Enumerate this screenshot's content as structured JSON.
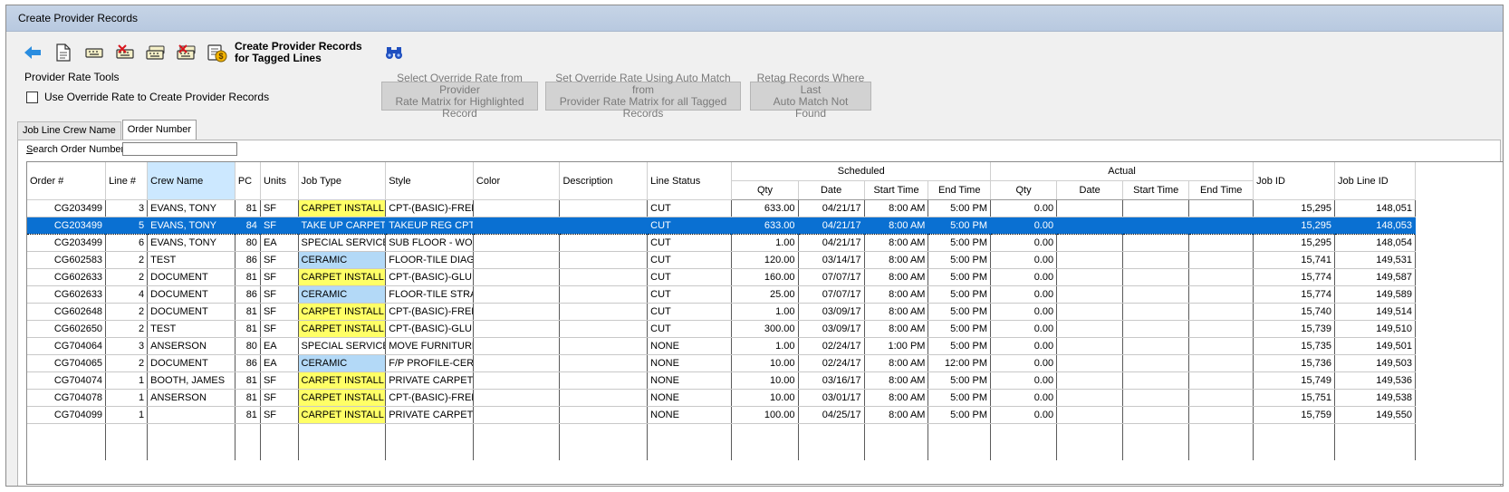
{
  "window": {
    "title": "Create Provider Records"
  },
  "toolbar": {
    "buttons": [
      {
        "icon": "back-arrow-icon"
      },
      {
        "icon": "document-page-icon"
      },
      {
        "icon": "keyboard-tag-icon"
      },
      {
        "icon": "keyboard-untag-icon"
      },
      {
        "icon": "keyboard-tag-all-icon"
      },
      {
        "icon": "keyboard-untag-all-icon"
      },
      {
        "icon": "provider-records-icon"
      },
      {
        "icon": "binoculars-find-icon"
      }
    ],
    "create_label_line1": "Create Provider Records",
    "create_label_line2": "for Tagged Lines"
  },
  "rate_tools": {
    "section_label": "Provider Rate Tools",
    "override_checkbox_label": "Use Override Rate to Create Provider Records",
    "override_checked": false,
    "btn_select_line1": "Select Override Rate from Provider",
    "btn_select_line2": "Rate Matrix for Highlighted Record",
    "btn_auto_line1": "Set Override Rate Using Auto Match from",
    "btn_auto_line2": "Provider Rate Matrix for all Tagged Records",
    "btn_retag_line1": "Retag Records Where Last",
    "btn_retag_line2": "Auto Match Not Found"
  },
  "tabs": [
    {
      "label": "Job Line Crew Name",
      "active": false
    },
    {
      "label": "Order Number",
      "active": true
    }
  ],
  "search": {
    "label_accel": "S",
    "label_rest": "earch Order Number",
    "value": ""
  },
  "grid": {
    "headers": {
      "order": "Order #",
      "line": "Line #",
      "crew": "Crew Name",
      "pc": "PC",
      "units": "Units",
      "job_type": "Job Type",
      "style": "Style",
      "color": "Color",
      "description": "Description",
      "line_status": "Line Status",
      "scheduled": "Scheduled",
      "actual": "Actual",
      "sched_qty": "Qty",
      "sched_date": "Date",
      "sched_start": "Start Time",
      "sched_end": "End Time",
      "act_qty": "Qty",
      "act_date": "Date",
      "act_start": "Start Time",
      "act_end": "End Time",
      "job_id": "Job ID",
      "job_line_id": "Job Line ID"
    },
    "colors": {
      "selected_row": "#0a70d2",
      "job_type_yellow": "#ffff66",
      "job_type_blue": "#b3d9f7"
    },
    "rows": [
      {
        "order": "CG203499",
        "line": "3",
        "crew": "EVANS, TONY",
        "pc": "81",
        "units": "SF",
        "job_type": "CARPET INSTALL",
        "jt_color": "yellow",
        "style": "CPT-(BASIC)-FREE",
        "color": "",
        "description": "",
        "status": "CUT",
        "qty": "633.00",
        "date": "04/21/17",
        "start": "8:00 AM",
        "end": "5:00 PM",
        "aqty": "0.00",
        "adate": "",
        "astart": "",
        "aend": "",
        "job_id": "15,295",
        "job_line_id": "148,051",
        "selected": false
      },
      {
        "order": "CG203499",
        "line": "5",
        "crew": "EVANS, TONY",
        "pc": "84",
        "units": "SF",
        "job_type": "TAKE UP CARPET",
        "jt_color": "",
        "style": "TAKEUP REG CPT",
        "color": "",
        "description": "",
        "status": "CUT",
        "qty": "633.00",
        "date": "04/21/17",
        "start": "8:00 AM",
        "end": "5:00 PM",
        "aqty": "0.00",
        "adate": "",
        "astart": "",
        "aend": "",
        "job_id": "15,295",
        "job_line_id": "148,053",
        "selected": true
      },
      {
        "order": "CG203499",
        "line": "6",
        "crew": "EVANS, TONY",
        "pc": "80",
        "units": "EA",
        "job_type": "SPECIAL SERVICE",
        "jt_color": "",
        "style": "SUB FLOOR - WO",
        "color": "",
        "description": "",
        "status": "CUT",
        "qty": "1.00",
        "date": "04/21/17",
        "start": "8:00 AM",
        "end": "5:00 PM",
        "aqty": "0.00",
        "adate": "",
        "astart": "",
        "aend": "",
        "job_id": "15,295",
        "job_line_id": "148,054",
        "selected": false
      },
      {
        "order": "CG602583",
        "line": "2",
        "crew": "TEST",
        "pc": "86",
        "units": "SF",
        "job_type": "CERAMIC",
        "jt_color": "blue",
        "style": "FLOOR-TILE DIAG",
        "color": "",
        "description": "",
        "status": "CUT",
        "qty": "120.00",
        "date": "03/14/17",
        "start": "8:00 AM",
        "end": "5:00 PM",
        "aqty": "0.00",
        "adate": "",
        "astart": "",
        "aend": "",
        "job_id": "15,741",
        "job_line_id": "149,531",
        "selected": false
      },
      {
        "order": "CG602633",
        "line": "2",
        "crew": "DOCUMENT",
        "pc": "81",
        "units": "SF",
        "job_type": "CARPET INSTALL",
        "jt_color": "yellow",
        "style": "CPT-(BASIC)-GLU",
        "color": "",
        "description": "",
        "status": "CUT",
        "qty": "160.00",
        "date": "07/07/17",
        "start": "8:00 AM",
        "end": "5:00 PM",
        "aqty": "0.00",
        "adate": "",
        "astart": "",
        "aend": "",
        "job_id": "15,774",
        "job_line_id": "149,587",
        "selected": false
      },
      {
        "order": "CG602633",
        "line": "4",
        "crew": "DOCUMENT",
        "pc": "86",
        "units": "SF",
        "job_type": "CERAMIC",
        "jt_color": "blue",
        "style": "FLOOR-TILE STRA",
        "color": "",
        "description": "",
        "status": "CUT",
        "qty": "25.00",
        "date": "07/07/17",
        "start": "8:00 AM",
        "end": "5:00 PM",
        "aqty": "0.00",
        "adate": "",
        "astart": "",
        "aend": "",
        "job_id": "15,774",
        "job_line_id": "149,589",
        "selected": false
      },
      {
        "order": "CG602648",
        "line": "2",
        "crew": "DOCUMENT",
        "pc": "81",
        "units": "SF",
        "job_type": "CARPET INSTALL",
        "jt_color": "yellow",
        "style": "CPT-(BASIC)-FREE",
        "color": "",
        "description": "",
        "status": "CUT",
        "qty": "1.00",
        "date": "03/09/17",
        "start": "8:00 AM",
        "end": "5:00 PM",
        "aqty": "0.00",
        "adate": "",
        "astart": "",
        "aend": "",
        "job_id": "15,740",
        "job_line_id": "149,514",
        "selected": false
      },
      {
        "order": "CG602650",
        "line": "2",
        "crew": "TEST",
        "pc": "81",
        "units": "SF",
        "job_type": "CARPET INSTALL",
        "jt_color": "yellow",
        "style": "CPT-(BASIC)-GLU",
        "color": "",
        "description": "",
        "status": "CUT",
        "qty": "300.00",
        "date": "03/09/17",
        "start": "8:00 AM",
        "end": "5:00 PM",
        "aqty": "0.00",
        "adate": "",
        "astart": "",
        "aend": "",
        "job_id": "15,739",
        "job_line_id": "149,510",
        "selected": false
      },
      {
        "order": "CG704064",
        "line": "3",
        "crew": "ANSERSON",
        "pc": "80",
        "units": "EA",
        "job_type": "SPECIAL SERVICE",
        "jt_color": "",
        "style": "MOVE FURNITURE",
        "color": "",
        "description": "",
        "status": "NONE",
        "qty": "1.00",
        "date": "02/24/17",
        "start": "1:00 PM",
        "end": "5:00 PM",
        "aqty": "0.00",
        "adate": "",
        "astart": "",
        "aend": "",
        "job_id": "15,735",
        "job_line_id": "149,501",
        "selected": false
      },
      {
        "order": "CG704065",
        "line": "2",
        "crew": "DOCUMENT",
        "pc": "86",
        "units": "EA",
        "job_type": "CERAMIC",
        "jt_color": "blue",
        "style": "F/P PROFILE-CERA",
        "color": "",
        "description": "",
        "status": "NONE",
        "qty": "10.00",
        "date": "02/24/17",
        "start": "8:00 AM",
        "end": "12:00 PM",
        "aqty": "0.00",
        "adate": "",
        "astart": "",
        "aend": "",
        "job_id": "15,736",
        "job_line_id": "149,503",
        "selected": false
      },
      {
        "order": "CG704074",
        "line": "1",
        "crew": "BOOTH, JAMES",
        "pc": "81",
        "units": "SF",
        "job_type": "CARPET INSTALL",
        "jt_color": "yellow",
        "style": "PRIVATE CARPET",
        "color": "",
        "description": "",
        "status": "NONE",
        "qty": "10.00",
        "date": "03/16/17",
        "start": "8:00 AM",
        "end": "5:00 PM",
        "aqty": "0.00",
        "adate": "",
        "astart": "",
        "aend": "",
        "job_id": "15,749",
        "job_line_id": "149,536",
        "selected": false
      },
      {
        "order": "CG704078",
        "line": "1",
        "crew": "ANSERSON",
        "pc": "81",
        "units": "SF",
        "job_type": "CARPET INSTALL",
        "jt_color": "yellow",
        "style": "CPT-(BASIC)-FREE",
        "color": "",
        "description": "",
        "status": "NONE",
        "qty": "10.00",
        "date": "03/01/17",
        "start": "8:00 AM",
        "end": "5:00 PM",
        "aqty": "0.00",
        "adate": "",
        "astart": "",
        "aend": "",
        "job_id": "15,751",
        "job_line_id": "149,538",
        "selected": false
      },
      {
        "order": "CG704099",
        "line": "1",
        "crew": "",
        "pc": "81",
        "units": "SF",
        "job_type": "CARPET INSTALL",
        "jt_color": "yellow",
        "style": "PRIVATE CARPET",
        "color": "",
        "description": "",
        "status": "NONE",
        "qty": "100.00",
        "date": "04/25/17",
        "start": "8:00 AM",
        "end": "5:00 PM",
        "aqty": "0.00",
        "adate": "",
        "astart": "",
        "aend": "",
        "job_id": "15,759",
        "job_line_id": "149,550",
        "selected": false
      }
    ]
  }
}
